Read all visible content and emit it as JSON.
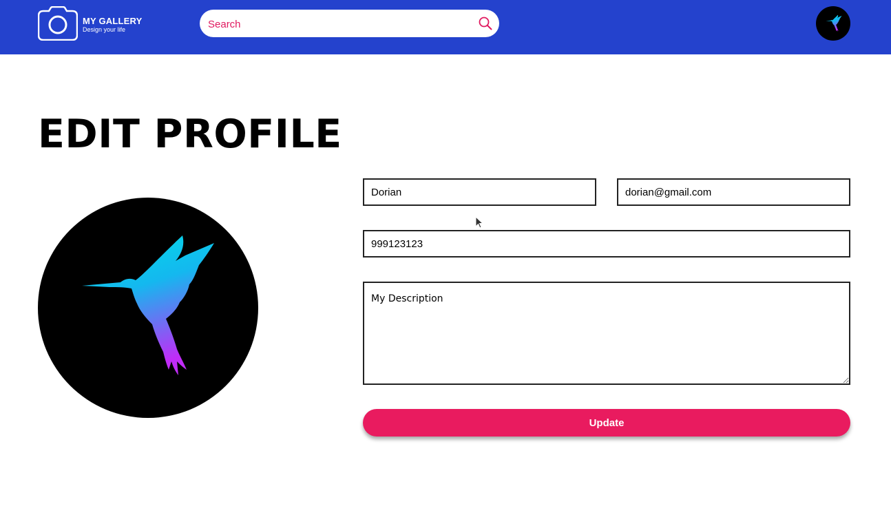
{
  "header": {
    "logo_title": "MY GALLERY",
    "logo_tagline": "Design your life",
    "search_placeholder": "Search",
    "search_value": ""
  },
  "page": {
    "title": "EDIT PROFILE"
  },
  "form": {
    "name_value": "Dorian",
    "email_value": "dorian@gmail.com",
    "phone_value": "999123123",
    "description_value": "My Description",
    "update_label": "Update"
  },
  "icons": {
    "logo": "camera-icon",
    "search": "search-icon",
    "avatar": "hummingbird-icon"
  },
  "colors": {
    "header_bg": "#2442cd",
    "accent": "#e91b5f",
    "bird_gradient_start": "#00e0e6",
    "bird_gradient_end": "#c02cf7"
  }
}
